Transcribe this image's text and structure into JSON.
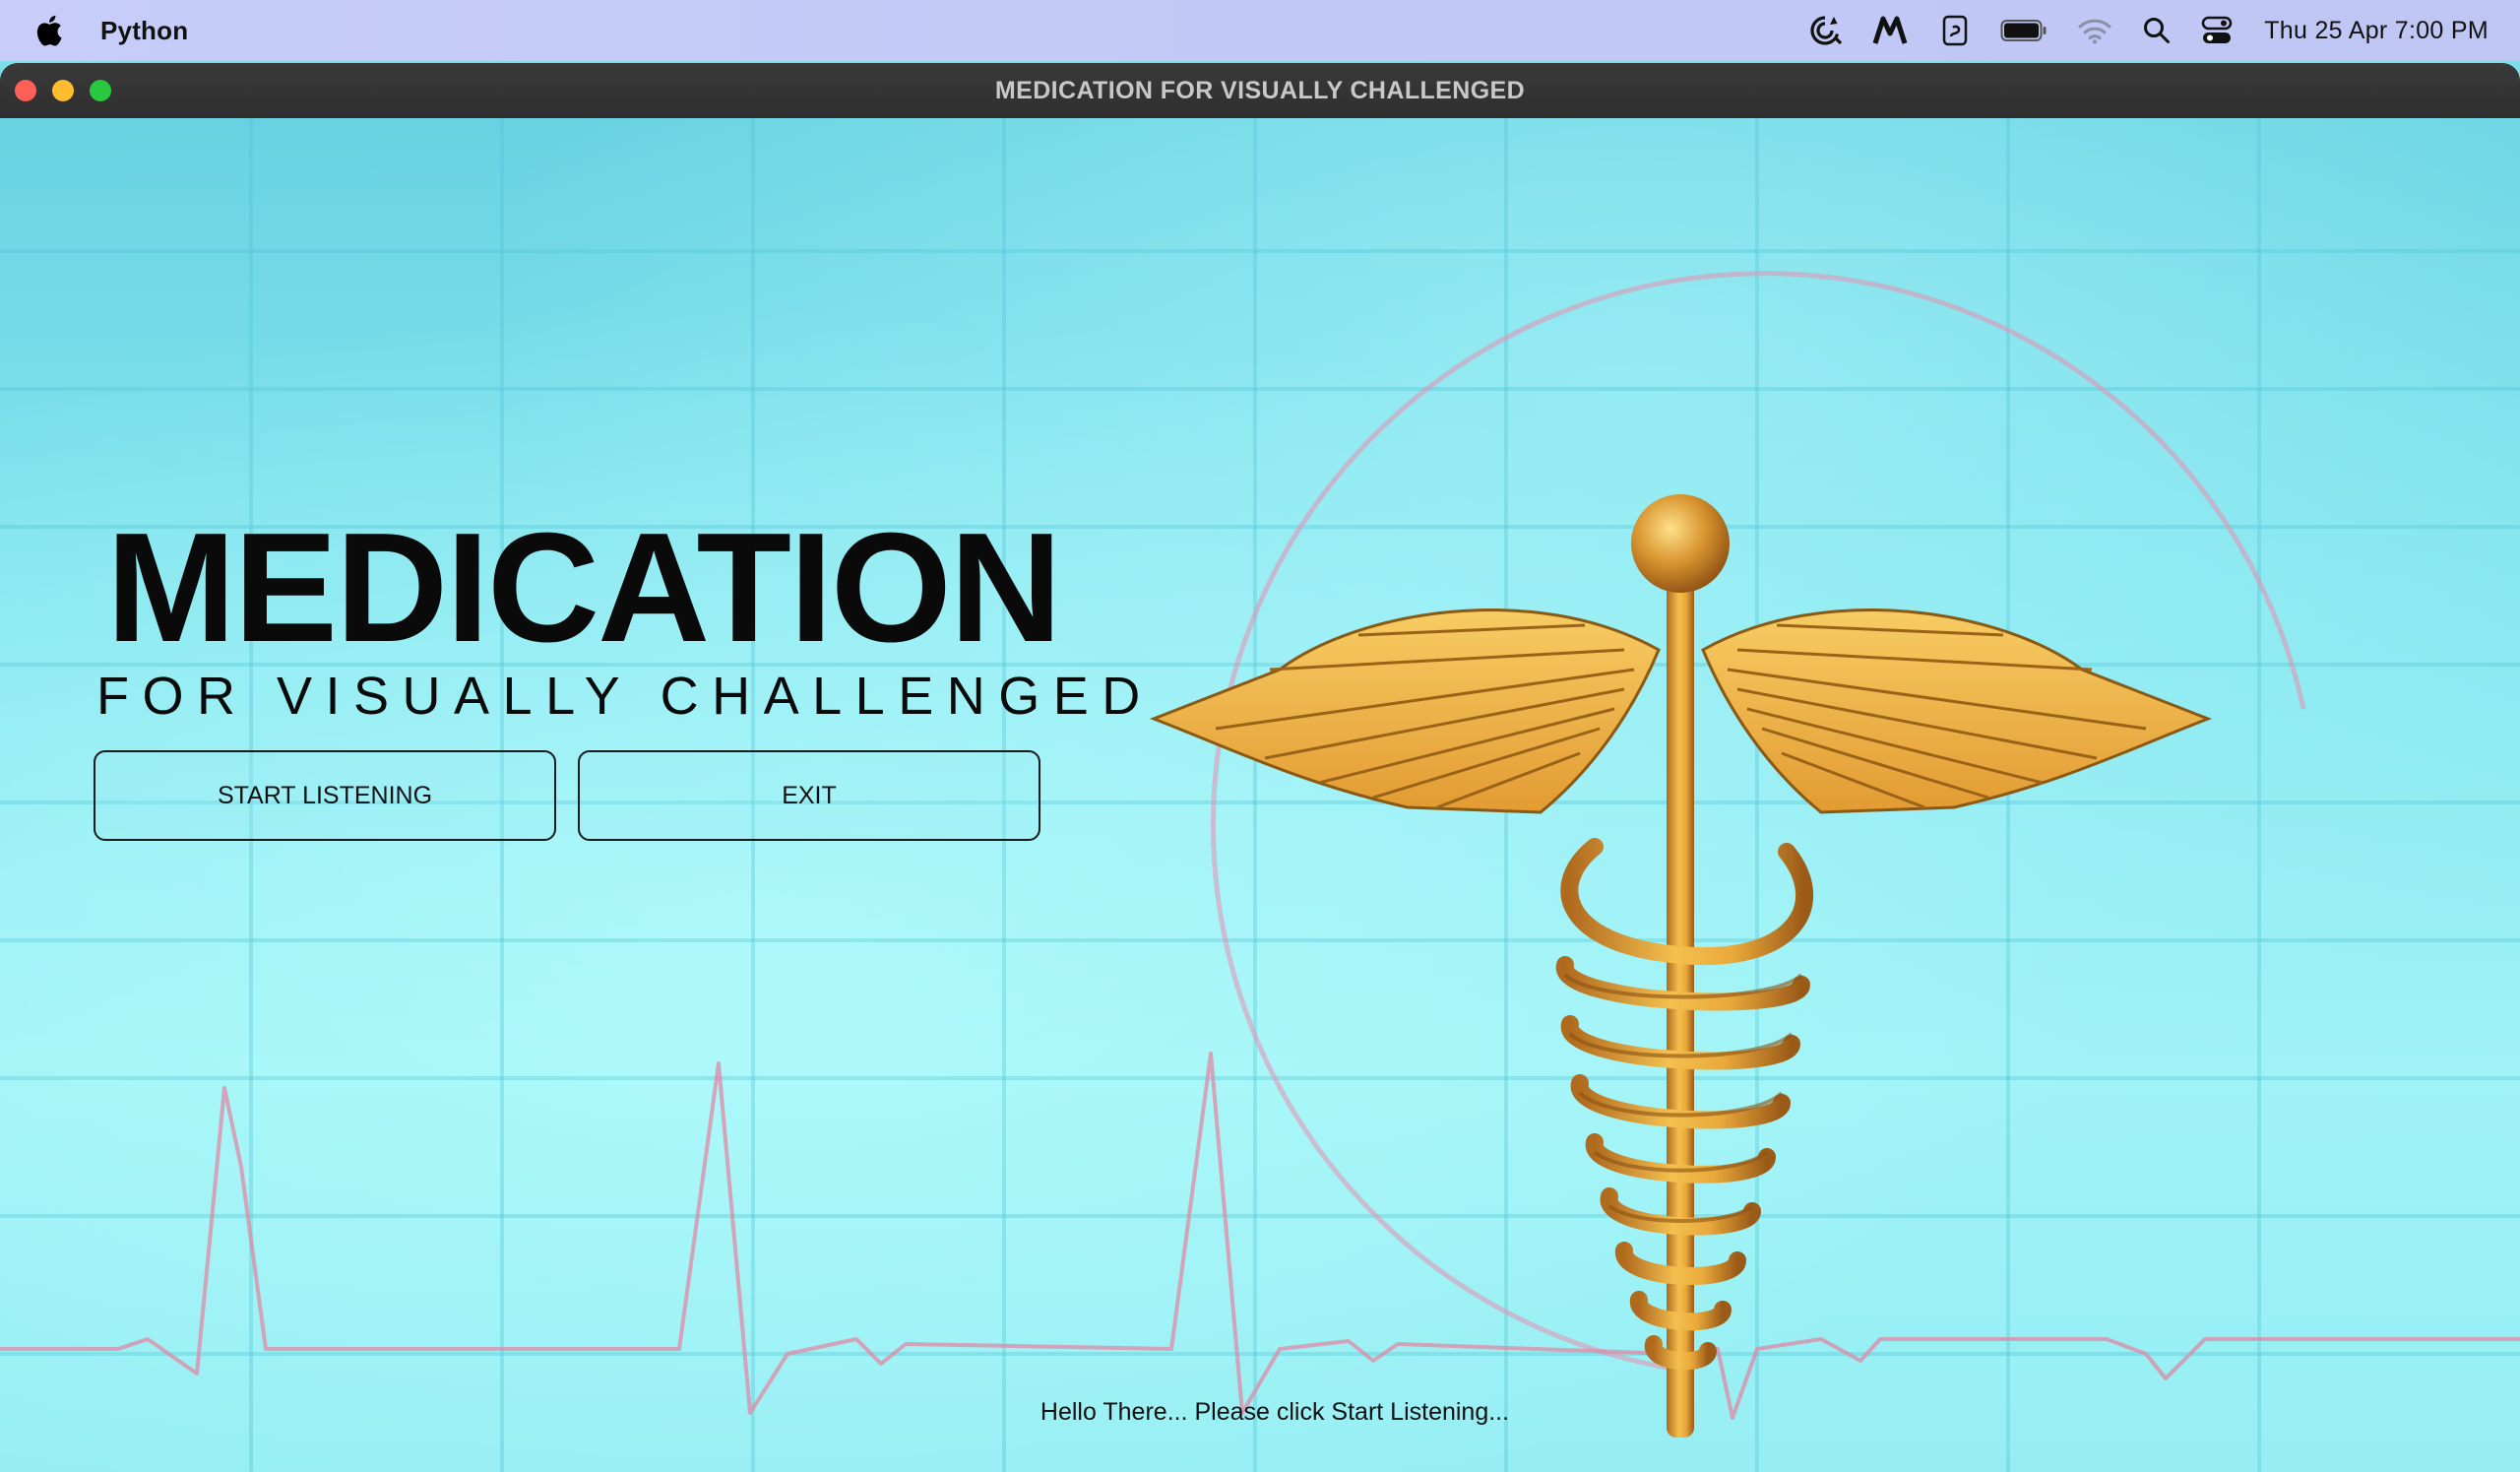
{
  "menubar": {
    "app_name": "Python",
    "clock": "Thu 25 Apr  7:00 PM",
    "icons": [
      "apple-icon",
      "sync-icon",
      "malwarebytes-icon",
      "script-icon",
      "battery-icon",
      "wifi-icon",
      "search-icon",
      "control-center-icon"
    ]
  },
  "window": {
    "title": "MEDICATION FOR VISUALLY CHALLENGED"
  },
  "main": {
    "title": "MEDICATION",
    "subtitle": "FOR VISUALLY CHALLENGED",
    "start_button_label": "START LISTENING",
    "exit_button_label": "EXIT",
    "status_message": "Hello There... Please click Start Listening..."
  },
  "colors": {
    "background": "#86e6ef",
    "caduceus_gold": "#e0a23a",
    "heartbeat_line": "#e88aa8",
    "traffic_close": "#fe5f57",
    "traffic_minimize": "#febc2e",
    "traffic_zoom": "#28c840"
  }
}
